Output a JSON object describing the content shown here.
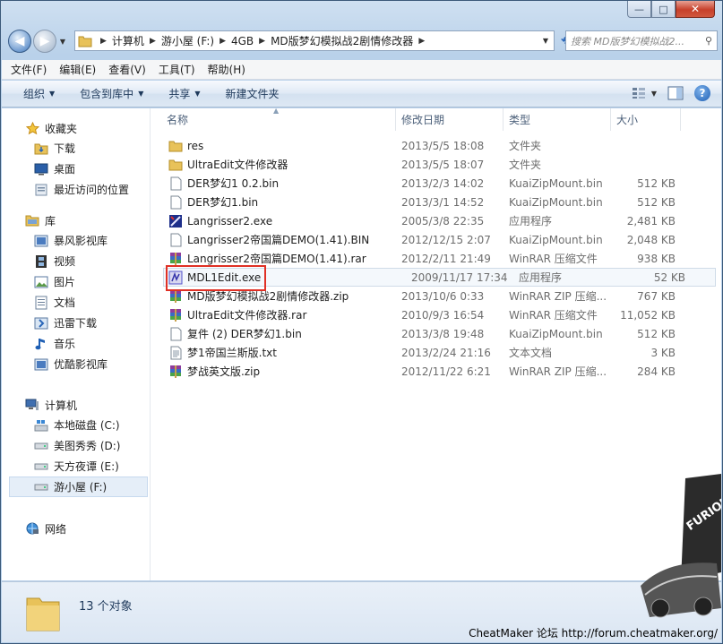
{
  "window": {
    "caption": {
      "minimize": "—",
      "maximize": "□",
      "close": "✕"
    }
  },
  "nav": {
    "breadcrumbs": [
      "计算机",
      "游小屋 (F:)",
      "4GB",
      "MD版梦幻模拟战2剧情修改器"
    ],
    "search_placeholder": "搜索 MD版梦幻模拟战2..."
  },
  "menubar": {
    "items": [
      "文件(F)",
      "编辑(E)",
      "查看(V)",
      "工具(T)",
      "帮助(H)"
    ]
  },
  "toolbar": {
    "organize": "组织",
    "include_library": "包含到库中",
    "share": "共享",
    "new_folder": "新建文件夹"
  },
  "sidebar": {
    "favorites_title": "收藏夹",
    "favorites": [
      "下载",
      "桌面",
      "最近访问的位置"
    ],
    "libraries_title": "库",
    "libraries": [
      "暴风影视库",
      "视频",
      "图片",
      "文档",
      "迅雷下载",
      "音乐",
      "优酷影视库"
    ],
    "computer_title": "计算机",
    "drives": [
      "本地磁盘 (C:)",
      "美图秀秀 (D:)",
      "天方夜谭 (E:)",
      "游小屋 (F:)"
    ],
    "network_title": "网络"
  },
  "columns": {
    "name": "名称",
    "date": "修改日期",
    "type": "类型",
    "size": "大小"
  },
  "files": [
    {
      "name": "res",
      "date": "2013/5/5 18:08",
      "type": "文件夹",
      "size": "",
      "icon": "folder"
    },
    {
      "name": "UltraEdit文件修改器",
      "date": "2013/5/5 18:07",
      "type": "文件夹",
      "size": "",
      "icon": "folder"
    },
    {
      "name": "DER梦幻1 0.2.bin",
      "date": "2013/2/3 14:02",
      "type": "KuaiZipMount.bin",
      "size": "512 KB",
      "icon": "file"
    },
    {
      "name": "DER梦幻1.bin",
      "date": "2013/3/1 14:52",
      "type": "KuaiZipMount.bin",
      "size": "512 KB",
      "icon": "file"
    },
    {
      "name": "Langrisser2.exe",
      "date": "2005/3/8 22:35",
      "type": "应用程序",
      "size": "2,481 KB",
      "icon": "exe-lang"
    },
    {
      "name": "Langrisser2帝国篇DEMO(1.41).BIN",
      "date": "2012/12/15 2:07",
      "type": "KuaiZipMount.bin",
      "size": "2,048 KB",
      "icon": "file"
    },
    {
      "name": "Langrisser2帝国篇DEMO(1.41).rar",
      "date": "2012/2/11 21:49",
      "type": "WinRAR 压缩文件",
      "size": "938 KB",
      "icon": "rar"
    },
    {
      "name": "MDL1Edit.exe",
      "date": "2009/11/17 17:34",
      "type": "应用程序",
      "size": "52 KB",
      "icon": "exe-mdl"
    },
    {
      "name": "MD版梦幻模拟战2剧情修改器.zip",
      "date": "2013/10/6 0:33",
      "type": "WinRAR ZIP 压缩...",
      "size": "767 KB",
      "icon": "rar"
    },
    {
      "name": "UltraEdit文件修改器.rar",
      "date": "2010/9/3 16:54",
      "type": "WinRAR 压缩文件",
      "size": "11,052 KB",
      "icon": "rar"
    },
    {
      "name": "复件 (2) DER梦幻1.bin",
      "date": "2013/3/8 19:48",
      "type": "KuaiZipMount.bin",
      "size": "512 KB",
      "icon": "file"
    },
    {
      "name": "梦1帝国兰斯版.txt",
      "date": "2013/2/24 21:16",
      "type": "文本文档",
      "size": "3 KB",
      "icon": "txt"
    },
    {
      "name": "梦战英文版.zip",
      "date": "2012/11/22 6:21",
      "type": "WinRAR ZIP 压缩...",
      "size": "284 KB",
      "icon": "rar"
    }
  ],
  "details": {
    "count": "13 个对象"
  },
  "watermark": "CheatMaker 论坛 http://forum.cheatmaker.org/",
  "colors": {
    "accent": "#e03025",
    "selection": "#e5eef8",
    "folder": "#e8c25a"
  }
}
